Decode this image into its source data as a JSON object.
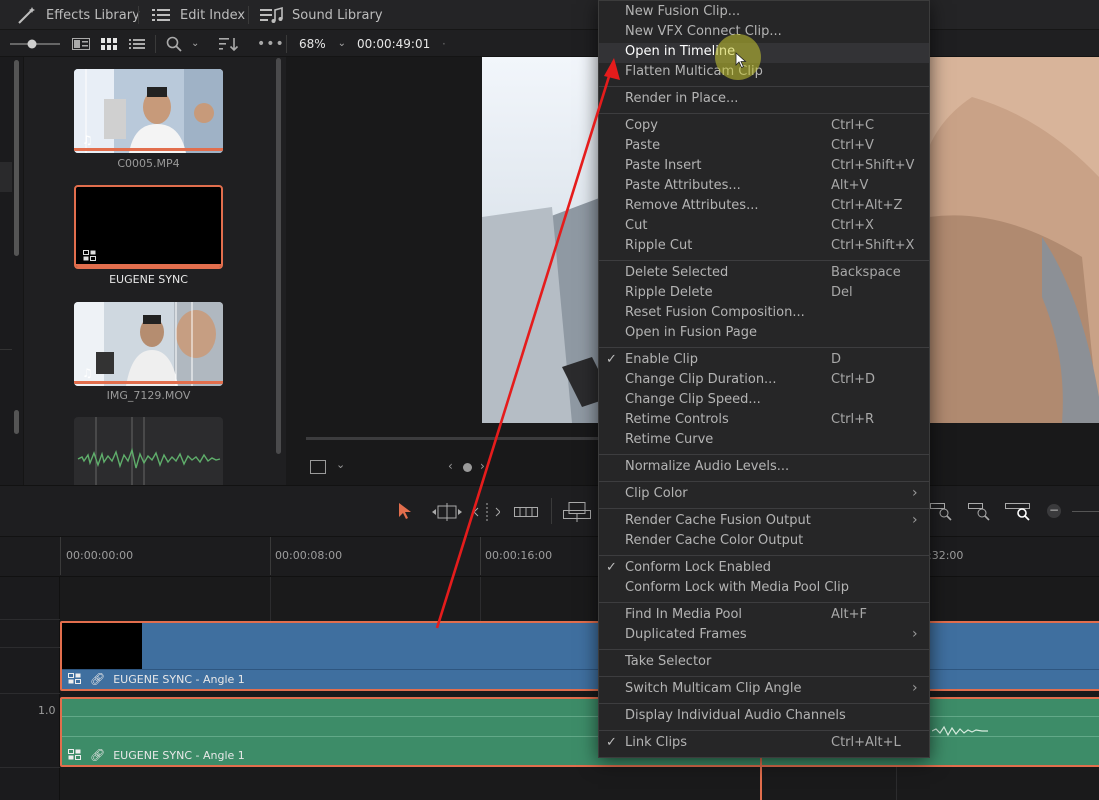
{
  "topbar": {
    "effects_library": "Effects Library",
    "edit_index": "Edit Index",
    "sound_library": "Sound Library"
  },
  "viewer": {
    "zoom": "68%",
    "timecode": "00:00:49:01"
  },
  "media_pool": {
    "clips": [
      {
        "name": "C0005.MP4"
      },
      {
        "name": "EUGENE SYNC"
      },
      {
        "name": "IMG_7129.MOV"
      },
      {
        "name": ""
      }
    ]
  },
  "timeline": {
    "timecodes": [
      "00:00:00:00",
      "00:00:08:00",
      "00:00:16:00",
      ":32:00"
    ],
    "audio_level": "1.0",
    "video_clip": "EUGENE SYNC - Angle 1",
    "audio_clip": "EUGENE SYNC - Angle 1"
  },
  "context_menu": {
    "items": [
      {
        "label": "New Fusion Clip...",
        "shortcut": ""
      },
      {
        "label": "New VFX Connect Clip...",
        "shortcut": ""
      },
      {
        "label": "Open in Timeline",
        "shortcut": ""
      },
      {
        "label": "Flatten Multicam Clip",
        "shortcut": ""
      },
      {
        "label": "Render in Place...",
        "shortcut": ""
      },
      {
        "label": "Copy",
        "shortcut": "Ctrl+C"
      },
      {
        "label": "Paste",
        "shortcut": "Ctrl+V"
      },
      {
        "label": "Paste Insert",
        "shortcut": "Ctrl+Shift+V"
      },
      {
        "label": "Paste Attributes...",
        "shortcut": "Alt+V"
      },
      {
        "label": "Remove Attributes...",
        "shortcut": "Ctrl+Alt+Z"
      },
      {
        "label": "Cut",
        "shortcut": "Ctrl+X"
      },
      {
        "label": "Ripple Cut",
        "shortcut": "Ctrl+Shift+X"
      },
      {
        "label": "Delete Selected",
        "shortcut": "Backspace"
      },
      {
        "label": "Ripple Delete",
        "shortcut": "Del"
      },
      {
        "label": "Reset Fusion Composition...",
        "shortcut": ""
      },
      {
        "label": "Open in Fusion Page",
        "shortcut": ""
      },
      {
        "label": "Enable Clip",
        "shortcut": "D"
      },
      {
        "label": "Change Clip Duration...",
        "shortcut": "Ctrl+D"
      },
      {
        "label": "Change Clip Speed...",
        "shortcut": ""
      },
      {
        "label": "Retime Controls",
        "shortcut": "Ctrl+R"
      },
      {
        "label": "Retime Curve",
        "shortcut": ""
      },
      {
        "label": "Normalize Audio Levels...",
        "shortcut": ""
      },
      {
        "label": "Clip Color",
        "shortcut": ""
      },
      {
        "label": "Render Cache Fusion Output",
        "shortcut": ""
      },
      {
        "label": "Render Cache Color Output",
        "shortcut": ""
      },
      {
        "label": "Conform Lock Enabled",
        "shortcut": ""
      },
      {
        "label": "Conform Lock with Media Pool Clip",
        "shortcut": ""
      },
      {
        "label": "Find In Media Pool",
        "shortcut": "Alt+F"
      },
      {
        "label": "Duplicated Frames",
        "shortcut": ""
      },
      {
        "label": "Take Selector",
        "shortcut": ""
      },
      {
        "label": "Switch Multicam Clip Angle",
        "shortcut": ""
      },
      {
        "label": "Display Individual Audio Channels",
        "shortcut": ""
      },
      {
        "label": "Link Clips",
        "shortcut": "Ctrl+Alt+L"
      }
    ]
  },
  "colors": {
    "accent": "#e26e4d",
    "video_clip": "#3f6f9f",
    "audio_clip": "#3d8c68",
    "annotation_arrow": "#e51c1c",
    "cursor_highlight": "#c8c832"
  }
}
